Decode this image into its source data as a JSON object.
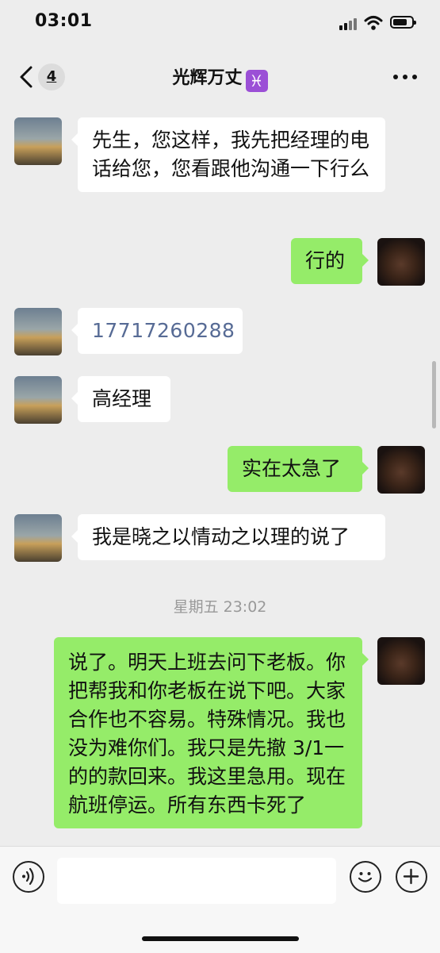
{
  "status_bar": {
    "time": "03:01"
  },
  "nav": {
    "unread_count": "4",
    "title": "光辉万丈",
    "title_sign": "♓"
  },
  "messages": [
    {
      "side": "left",
      "text": "先生，您这样，我先把经理的电话给您，您看跟他沟通一下行么"
    },
    {
      "side": "right",
      "text": "行的"
    },
    {
      "side": "left",
      "text": "17717260288"
    },
    {
      "side": "left",
      "text": "高经理"
    },
    {
      "side": "right",
      "text": "实在太急了"
    },
    {
      "side": "left",
      "text": "我是晓之以情动之以理的说了"
    },
    {
      "side": "right",
      "text": "说了。明天上班去问下老板。你把帮我和你老板在说下吧。大家合作也不容易。特殊情况。我也没为难你们。我只是先撤 3/1一的的款回来。我这里急用。现在航班停运。所有东西卡死了"
    }
  ],
  "timestamp": "星期五 23:02",
  "colors": {
    "background": "#ededed",
    "bubble_self": "#95ec69",
    "bubble_other": "#ffffff",
    "link": "#576b95"
  },
  "icons": {
    "back": "chevron-left-icon",
    "more": "more-dots-icon",
    "voice": "voice-icon",
    "emoji": "emoji-icon",
    "plus": "plus-icon"
  }
}
